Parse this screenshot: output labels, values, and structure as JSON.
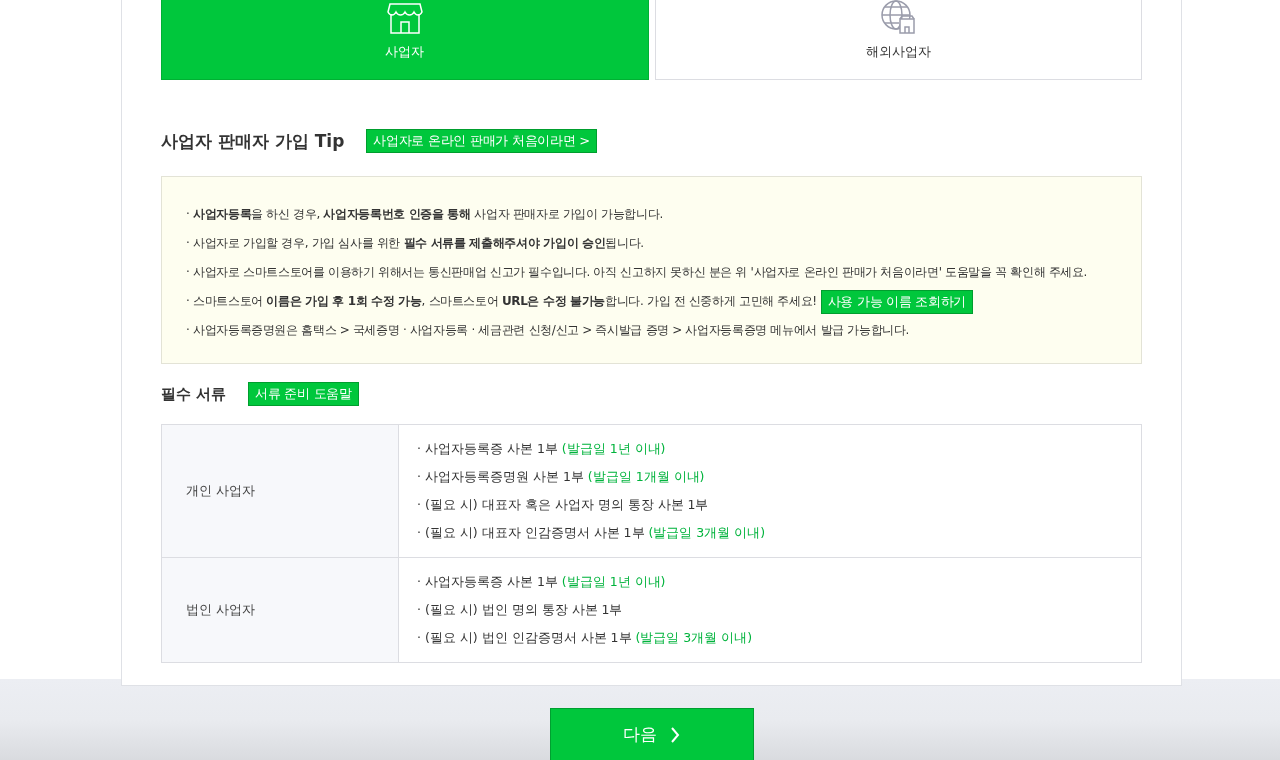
{
  "seller_types": [
    {
      "label": "사업자",
      "kind": "domestic",
      "selected": true
    },
    {
      "label": "해외사업자",
      "kind": "overseas",
      "selected": false
    }
  ],
  "tip": {
    "title": "사업자 판매자 가입 Tip",
    "help_button": "사업자로 온라인 판매가 처음이라면 >",
    "items": [
      {
        "text": "· **사업자등록**을 하신 경우, **사업자등록번호 인증을 통해** 사업자 판매자로 가입이 가능합니다."
      },
      {
        "text": "· 사업자로 가입할 경우, 가입 심사를 위한 **필수 서류를 제출해주셔야 가입이 승인**됩니다."
      },
      {
        "text": "· 사업자로 스마트스토어를 이용하기 위해서는 통신판매업 신고가 필수입니다. 아직 신고하지 못하신 분은 위 '사업자로 온라인 판매가 처음이라면' 도움말을 꼭 확인해 주세요."
      },
      {
        "text": "· 스마트스토어 **이름은 가입 후 1회 수정 가능**, 스마트스토어 **URL은 수정 불가능**합니다. 가입 전 신중하게 고민해 주세요!",
        "button": "사용 가능 이름 조회하기"
      },
      {
        "text": "· 사업자등록증명원은 홈택스 > 국세증명 · 사업자등록 · 세금관련 신청/신고 > 즉시발급 증명 > 사업자등록증명 메뉴에서 발급 가능합니다."
      }
    ]
  },
  "required_documents": {
    "title": "필수 서류",
    "help_button": "서류 준비 도움말",
    "rows": [
      {
        "type": "개인 사업자",
        "documents": [
          {
            "text": "· 사업자등록증 사본 1부",
            "note": "(발급일 1년 이내)"
          },
          {
            "text": "· 사업자등록증명원 사본 1부",
            "note": "(발급일 1개월 이내)"
          },
          {
            "text": "· (필요 시) 대표자 혹은 사업자 명의 통장 사본 1부"
          },
          {
            "text": "· (필요 시) 대표자 인감증명서 사본 1부",
            "note": "(발급일 3개월 이내)"
          }
        ]
      },
      {
        "type": "법인 사업자",
        "documents": [
          {
            "text": "· 사업자등록증 사본 1부",
            "note": "(발급일 1년 이내)"
          },
          {
            "text": "· (필요 시) 법인 명의 통장 사본 1부"
          },
          {
            "text": "· (필요 시) 법인 인감증명서 사본 1부",
            "note": "(발급일 3개월 이내)"
          }
        ]
      }
    ]
  },
  "next_button": "다음"
}
